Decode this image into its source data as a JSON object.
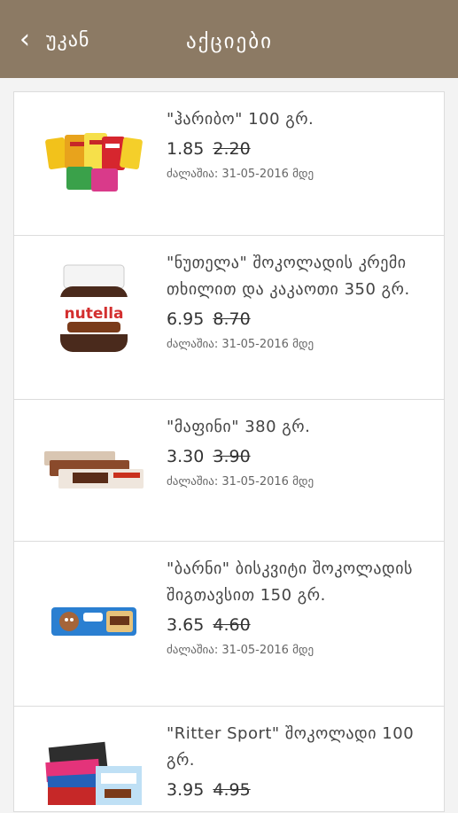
{
  "header": {
    "back_label": "უკან",
    "title": "აქციები"
  },
  "products": [
    {
      "name": "\"ჰარიბო\" 100 გრ.",
      "price": "1.85",
      "old_price": "2.20",
      "valid": "ძალაშია: 31-05-2016 მდე",
      "icon": "haribo-bags-icon"
    },
    {
      "name": "\"ნუთელა\" შოკოლადის კრემი თხილით და კაკაოთი 350 გრ.",
      "price": "6.95",
      "old_price": "8.70",
      "valid": "ძალაშია: 31-05-2016 მდე",
      "icon": "nutella-jar-icon",
      "brand_text": "nutella"
    },
    {
      "name": "\"მაფინი\" 380 გრ.",
      "price": "3.30",
      "old_price": "3.90",
      "valid": "ძალაშია: 31-05-2016 მდე",
      "icon": "muffin-packs-icon"
    },
    {
      "name": "\"ბარნი\" ბისკვიტი შოკოლადის შიგთავსით 150 გრ.",
      "price": "3.65",
      "old_price": "4.60",
      "valid": "ძალაშია: 31-05-2016 მდე",
      "icon": "barni-pack-icon"
    },
    {
      "name": "\"Ritter Sport\" შოკოლადი 100 გრ.",
      "price": "3.95",
      "old_price": "4.95",
      "valid": "",
      "icon": "ritter-sport-icon"
    }
  ]
}
